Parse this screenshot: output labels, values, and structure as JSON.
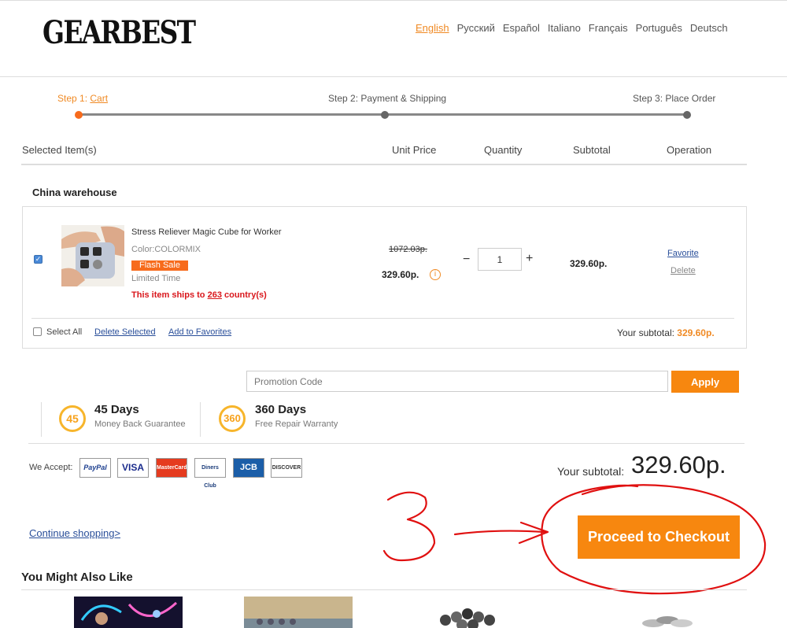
{
  "brand": {
    "logo": "GEARBEST"
  },
  "languages": [
    "English",
    "Русский",
    "Español",
    "Italiano",
    "Français",
    "Português",
    "Deutsch"
  ],
  "steps": {
    "step1_prefix": "Step 1: ",
    "step1_link": "Cart",
    "step2": "Step 2: Payment & Shipping",
    "step3": "Step 3: Place Order"
  },
  "table_headers": {
    "items": "Selected Item(s)",
    "unit_price": "Unit Price",
    "quantity": "Quantity",
    "subtotal": "Subtotal",
    "operation": "Operation"
  },
  "warehouse": "China warehouse",
  "item": {
    "name": "Stress Reliever Magic Cube for Worker",
    "color": "Color:COLORMIX",
    "flash_badge": "Flash Sale",
    "limited": "Limited Time",
    "ships_prefix": "This item ships to ",
    "ships_count": "263",
    "ships_suffix": " country(s)",
    "old_price": "1072.03р.",
    "price": "329.60р.",
    "price_info_glyph": "i",
    "minus": "−",
    "quantity": "1",
    "plus": "+",
    "subtotal": "329.60р.",
    "favorite": "Favorite",
    "delete": "Delete"
  },
  "cart_actions": {
    "select_all": "Select All",
    "delete_selected": "Delete Selected",
    "add_favorites": "Add to Favorites",
    "your_subtotal_label": "Your subtotal: ",
    "your_subtotal_value": "329.60р."
  },
  "promo": {
    "placeholder": "Promotion Code",
    "apply": "Apply"
  },
  "guarantees": [
    {
      "badge": "45",
      "title": "45 Days",
      "sub": "Money Back Guarantee"
    },
    {
      "badge": "360",
      "title": "360 Days",
      "sub": "Free Repair Warranty"
    }
  ],
  "payment": {
    "label": "We Accept:",
    "cards": [
      "PayPal",
      "VISA",
      "MasterCard",
      "Diners Club",
      "JCB",
      "DISCOVER"
    ]
  },
  "summary": {
    "label": "Your subtotal:",
    "value": "329.60р."
  },
  "continue": "Continue shopping>",
  "checkout": "Proceed to Checkout",
  "might_like": {
    "title": "You Might Also Like"
  },
  "colors": {
    "accent": "#f7870f",
    "link": "#2a4f9a",
    "alert": "#d9161b",
    "annotation": "#e01010"
  }
}
